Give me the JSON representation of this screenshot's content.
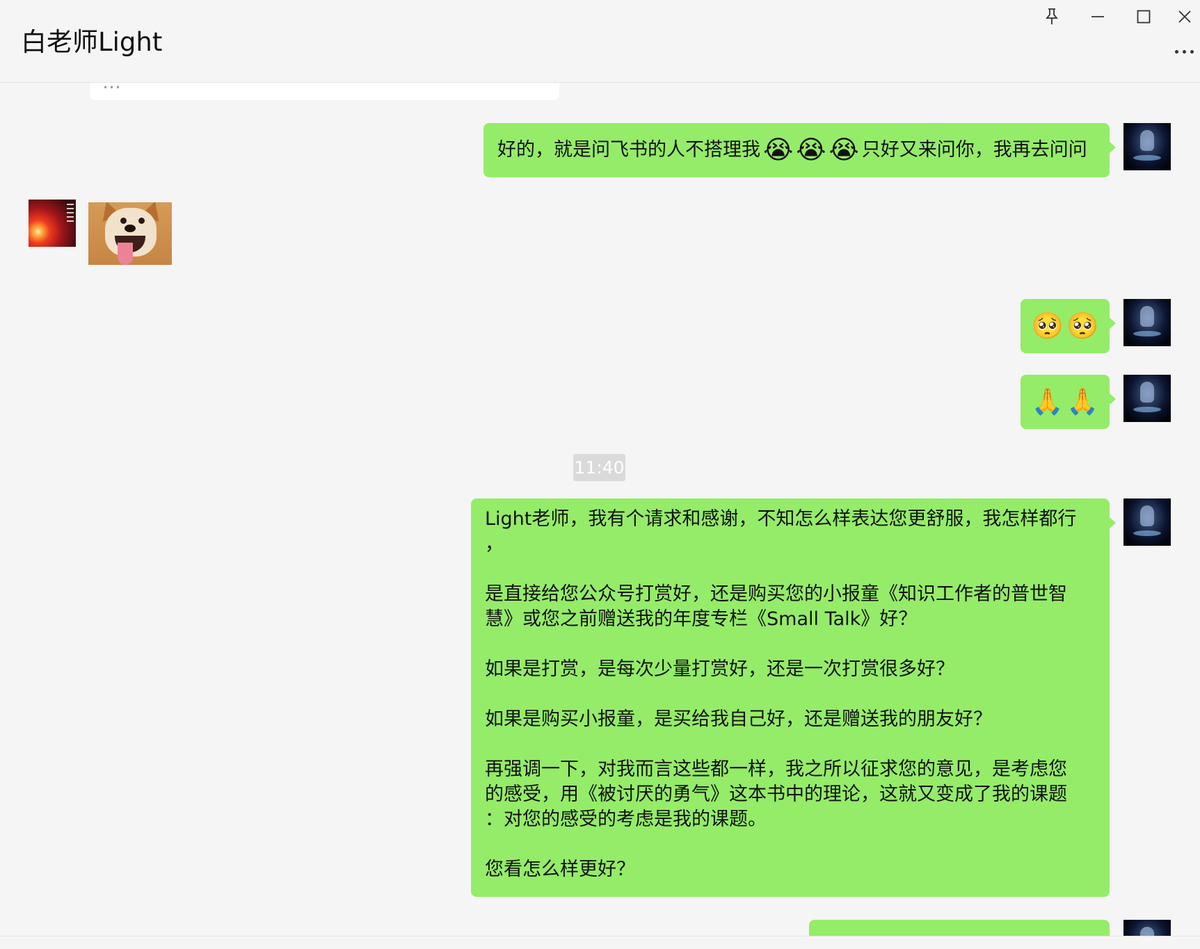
{
  "window": {
    "title": "白老师Light",
    "controls": {
      "pin": "pin-icon",
      "minimize": "minimize-icon",
      "maximize": "maximize-icon",
      "close": "close-icon",
      "more": "more-icon"
    }
  },
  "messages": {
    "m0": {
      "sender": "other",
      "type": "text",
      "text": "…"
    },
    "m1": {
      "sender": "me",
      "type": "text",
      "text_before": "好的，就是问飞书的人不搭理我",
      "emojis": [
        "😭",
        "😭",
        "😭"
      ],
      "text_after": "只好又来问你，我再去问问"
    },
    "m2": {
      "sender": "other",
      "type": "sticker",
      "sticker": "shiba-dog-sticker"
    },
    "m3": {
      "sender": "me",
      "type": "emoji",
      "emojis": [
        "🥺",
        "🥺"
      ]
    },
    "m4": {
      "sender": "me",
      "type": "emoji",
      "emojis": [
        "🙏",
        "🙏"
      ]
    },
    "timestamp": "11:40",
    "m5": {
      "sender": "me",
      "type": "text",
      "p1": "Light老师，我有个请求和感谢，不知怎么样表达您更舒服，我怎样都行",
      "p1b": "，",
      "p2a": "是直接给您公众号打赏好，还是购买您的小报童《知识工作者的普世智",
      "p2b": "慧》或您之前赠送我的年度专栏《Small Talk》好？",
      "p3": "如果是打赏，是每次少量打赏好，还是一次打赏很多好？",
      "p4": "如果是购买小报童，是买给我自己好，还是赠送我的朋友好？",
      "p5a": "再强调一下，对我而言这些都一样，我之所以征求您的意见，是考虑您",
      "p5b": "的感受，用《被讨厌的勇气》这本书中的理论，这就又变成了我的课题",
      "p5c": "：对您的感受的考虑是我的课题。",
      "p6": "您看怎么样更好？"
    },
    "m6": {
      "sender": "me",
      "type": "text",
      "text": "…"
    }
  }
}
